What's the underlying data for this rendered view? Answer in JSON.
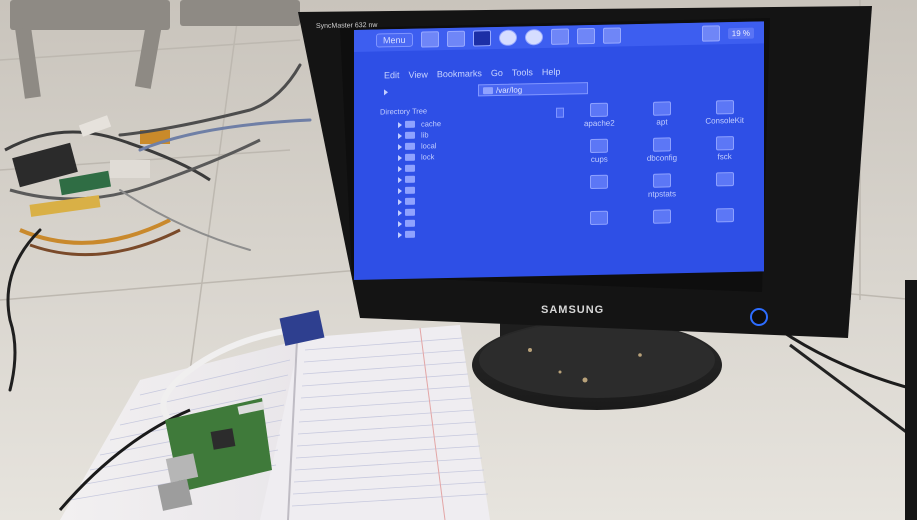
{
  "monitor": {
    "model_label": "SyncMaster 632 nw",
    "brand_label": "SAMSUNG"
  },
  "screen": {
    "taskbar": {
      "menu_label": "Menu",
      "clock_label": "19 %"
    },
    "menubar": {
      "items": [
        "Edit",
        "View",
        "Bookmarks",
        "Go",
        "Tools",
        "Help"
      ]
    },
    "address": {
      "path": "/var/log"
    },
    "sidebar": {
      "heading": "Directory Tree",
      "items": [
        "cache",
        "lib",
        "local",
        "lock",
        "",
        "",
        "",
        "",
        "",
        "",
        ""
      ]
    },
    "files": [
      "apache2",
      "apt",
      "ConsoleKit",
      "cups",
      "dbconfig",
      "fsck",
      "",
      "ntpstats",
      "",
      "",
      "",
      "",
      "",
      "",
      ""
    ],
    "files_extra": [
      "",
      "",
      "",
      "",
      "",
      "",
      "",
      "",
      "",
      "",
      "",
      "",
      "",
      "",
      ""
    ]
  },
  "colors": {
    "screen_bg": "#2e4fe6",
    "monitor_bezel": "#141414",
    "floor": "#d9d6cf",
    "pcb_green": "#3f7a3a"
  }
}
